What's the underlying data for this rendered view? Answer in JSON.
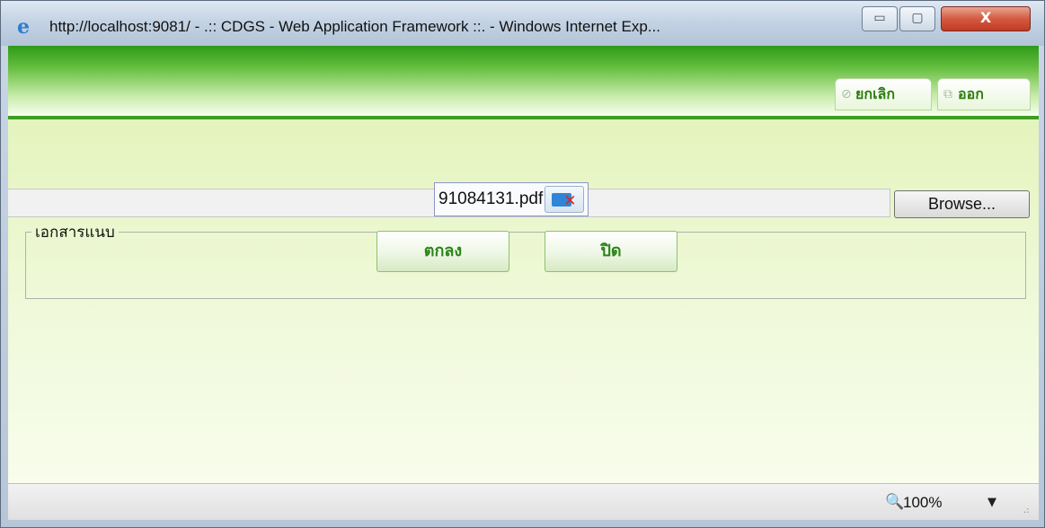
{
  "window": {
    "title": "http://localhost:9081/ - .:: CDGS - Web Application Framework ::. - Windows Internet Exp...",
    "icon": "ie-icon",
    "controls": {
      "minimize": "▭",
      "maximize": "▢",
      "close": "X"
    }
  },
  "header": {
    "cancel_label": "ยกเลิก",
    "cancel_icon": "⊘",
    "exit_label": "ออก",
    "exit_icon": "⧉"
  },
  "upload": {
    "file_value": "",
    "browse_label": "Browse..."
  },
  "attachments": {
    "legend": "เอกสารแนบ",
    "files": [
      {
        "name": "91084131.pdf"
      }
    ]
  },
  "actions": {
    "ok_label": "ตกลง",
    "close_label": "ปิด"
  },
  "statusbar": {
    "zoom": "100%",
    "zoom_icon": "🔍",
    "caret": "▼",
    "grip": ".:"
  },
  "colors": {
    "header_green": "#3f9d22",
    "button_text_green": "#2c8419",
    "body_green": "#e4f4bd",
    "close_red": "#c13b23"
  }
}
